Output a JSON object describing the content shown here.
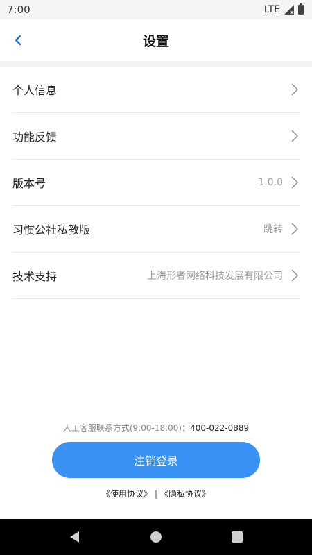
{
  "status_bar": {
    "time": "7:00",
    "network": "LTE",
    "icons": [
      "signal-icon",
      "battery-icon"
    ]
  },
  "header": {
    "title": "设置",
    "back_icon": "chevron-left-icon"
  },
  "colors": {
    "accent": "#3a92f5",
    "back_arrow": "#1f6fe0",
    "secondary_text": "#9a9a9a"
  },
  "menu": {
    "items": [
      {
        "label": "个人信息",
        "value": ""
      },
      {
        "label": "功能反馈",
        "value": ""
      },
      {
        "label": "版本号",
        "value": "1.0.0"
      },
      {
        "label": "习惯公社私教版",
        "value": "跳转"
      },
      {
        "label": "技术支持",
        "value": "上海形者网络科技发展有限公司"
      }
    ]
  },
  "footer": {
    "contact_label": "人工客服联系方式(9:00-18:00)：",
    "contact_phone": "400-022-0889",
    "logout_label": "注销登录",
    "terms_label": "《使用协议》",
    "separator": "|",
    "privacy_label": "《隐私协议》"
  },
  "nav_bar": {
    "icons": [
      "back-triangle-icon",
      "home-circle-icon",
      "recents-square-icon"
    ]
  }
}
